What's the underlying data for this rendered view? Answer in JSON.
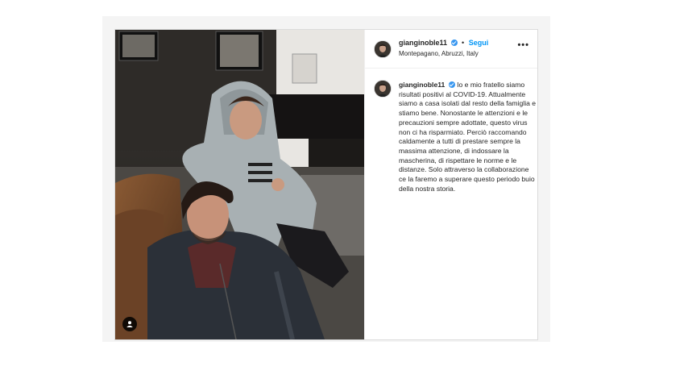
{
  "post": {
    "username": "gianginoble11",
    "follow_label": "Segui",
    "separator": "•",
    "location": "Montepagano, Abruzzi, Italy",
    "more_label": "•••",
    "caption": "Io e mio fratello siamo risultati positivi al COVID-19. Attualmente siamo a casa isolati dal resto della famiglia e stiamo bene. Nonostante le attenzioni e le precauzioni sempre adottate, questo virus non ci ha risparmiato. Perciò raccomando caldamente a tutti di prestare sempre la massima attenzione, di indossare la mascherina, di rispettare le norme e le distanze. Solo attraverso la collaborazione ce la faremo a superare questo periodo buio della nostra storia."
  },
  "colors": {
    "follow": "#0095f6",
    "verified": "#3897f0",
    "text": "#262626",
    "border": "#dbdbdb"
  },
  "icons": {
    "verified": "verified-badge-icon",
    "tag": "user-tag-icon",
    "more": "more-options-icon"
  }
}
